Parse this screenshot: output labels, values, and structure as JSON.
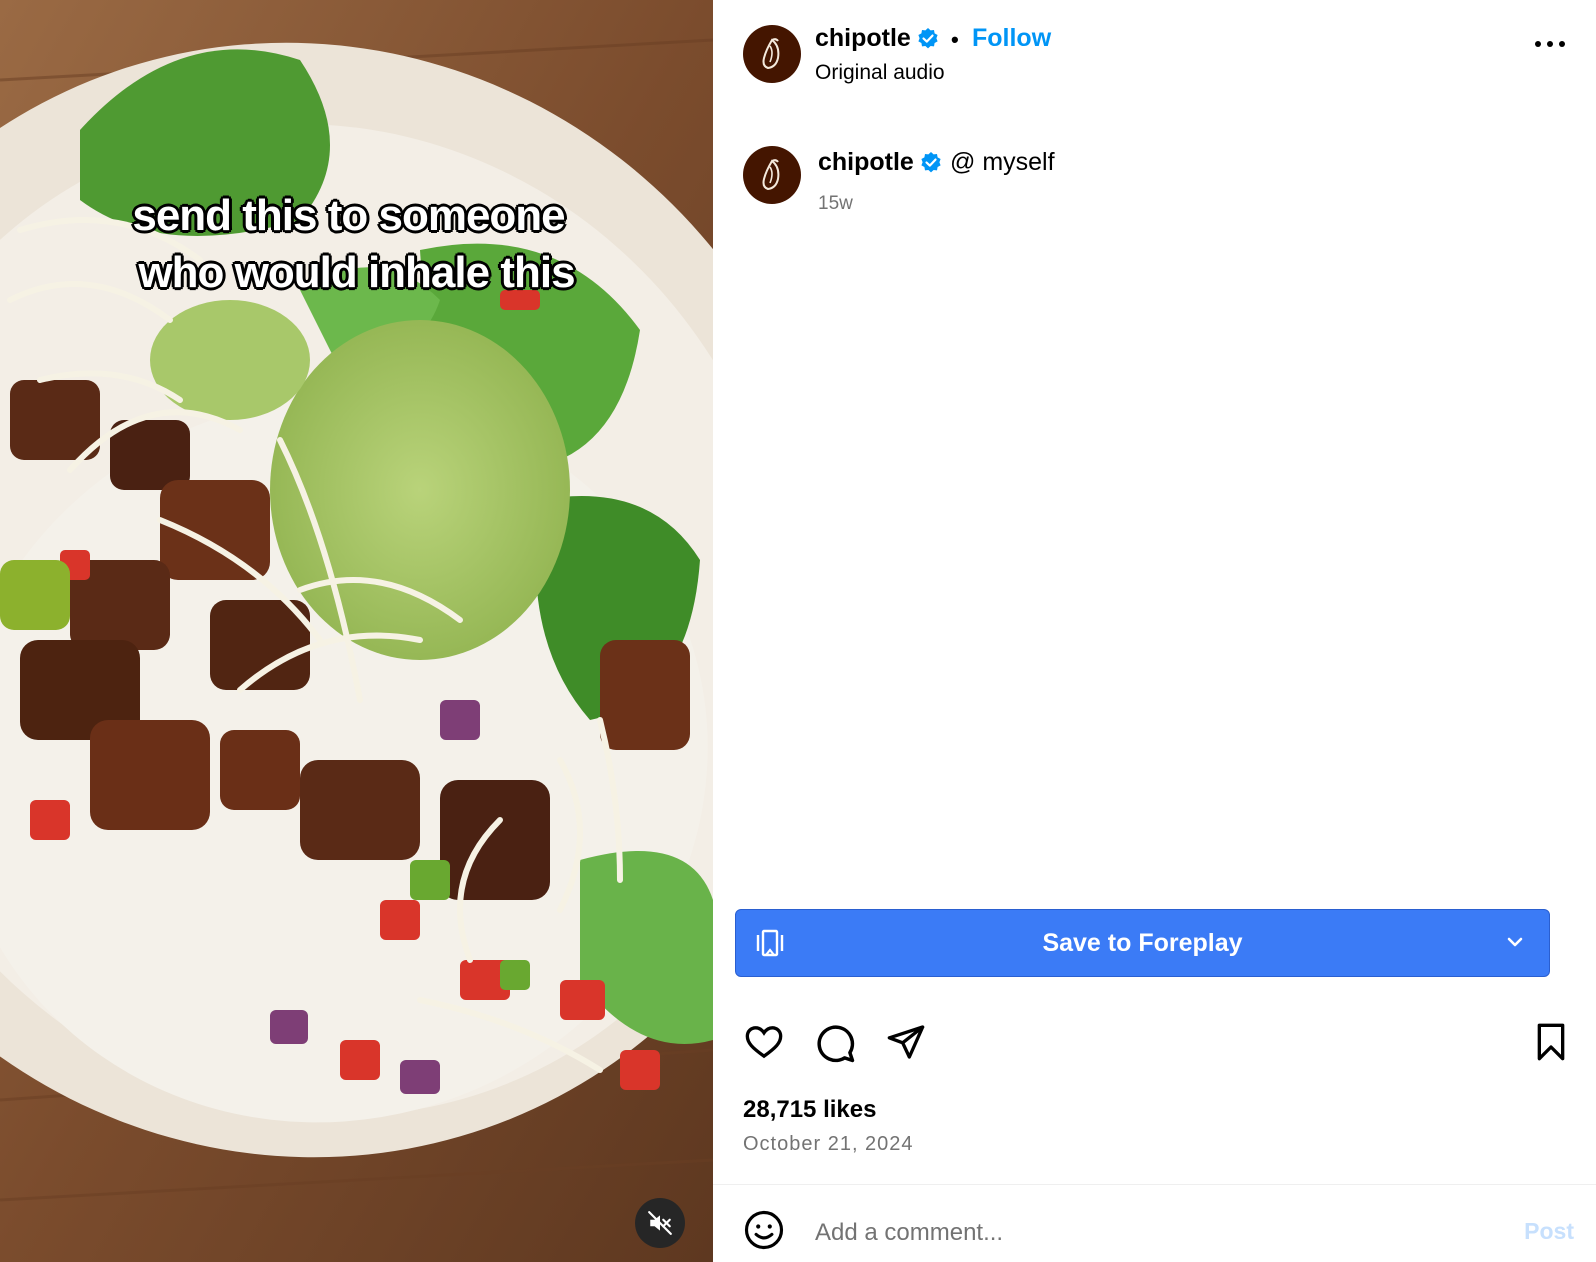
{
  "media": {
    "overlay_line1": "send this to someone",
    "overlay_line2": "who would inhale this",
    "mute_icon": "speaker-muted-icon"
  },
  "header": {
    "username": "chipotle",
    "verified_icon": "verified-badge-icon",
    "separator": "•",
    "follow_label": "Follow",
    "audio_label": "Original audio",
    "more_icon": "more-options-icon"
  },
  "caption": {
    "username": "chipotle",
    "text": "@ myself",
    "time": "15w"
  },
  "save_button": {
    "label": "Save to Foreplay",
    "left_icon": "save-collection-icon",
    "chevron_icon": "chevron-down-icon"
  },
  "actions": {
    "like_icon": "heart-icon",
    "comment_icon": "comment-icon",
    "share_icon": "share-icon",
    "bookmark_icon": "bookmark-icon"
  },
  "stats": {
    "likes": "28,715 likes",
    "date": "October 21, 2024"
  },
  "comment_box": {
    "placeholder": "Add a comment...",
    "post_label": "Post"
  },
  "colors": {
    "accent_blue": "#0095f6",
    "save_button_bg": "#3b7bf6",
    "avatar_bg": "#441500",
    "muted_text": "#737373"
  }
}
